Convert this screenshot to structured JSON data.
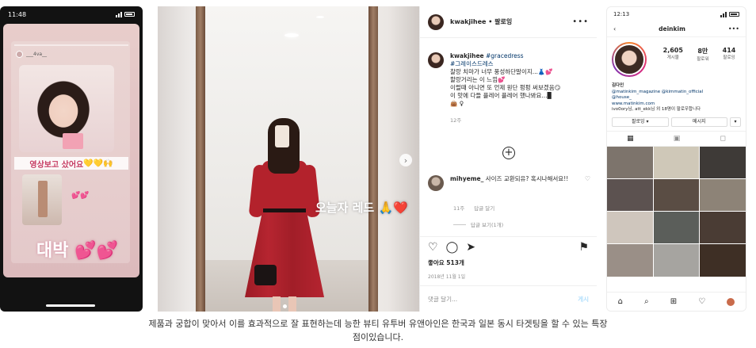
{
  "story": {
    "time": "11:48",
    "username": "___4va__",
    "caption": "영상보고 샀어요",
    "emoji": "💛💛🙌",
    "hearts": "💕💕",
    "big_text": "대박",
    "big_emoji": "💕💕"
  },
  "photo": {
    "overlay_text": "오늘자 레드",
    "overlay_emoji": "🙏❤️",
    "next_icon": "chevron-right-icon"
  },
  "post": {
    "header_user": "kwakjihee",
    "header_follow": "• 팔로잉",
    "more": "•••",
    "caption_user": "kwakjihee",
    "caption_tag1": "#gracedress",
    "caption_tag2": "#그레이스드레스",
    "caption_lines": [
      "찰랑 치마가 너무 풍성하단말이지...👗💕",
      "할랑거리는 이 느낌💕",
      "이럴때 아니면 또 언제 원단 펑펑 써보겠음😏",
      "이 맛에 다들 플레어 플레어 했나봐요...▉",
      "👜 ♀"
    ],
    "caption_ago": "12주",
    "comment_user": "mihyeme_",
    "comment_text": "사이즈 교환되유? 혹시나해서요!!",
    "comment_ago": "11주",
    "comment_reply": "답글 달기",
    "view_replies": "답글 보기(1개)",
    "likes": "좋아요 513개",
    "date": "2018년 11월 1일",
    "add_comment_placeholder": "댓글 달기...",
    "post_label": "게시"
  },
  "profile": {
    "time": "12:13",
    "username": "deinkim",
    "posts_count": "2,605",
    "posts_label": "게시물",
    "followers_count": "8만",
    "followers_label": "팔로워",
    "following_count": "414",
    "following_label": "팔로잉",
    "bio_name": "김다인",
    "bio_links1": "@matinkim_magazine @kimmatin_official",
    "bio_links2": "@house_",
    "bio_url": "www.matinkim.com",
    "bio_followers": "ivo0ory님, att_ekk님 외 18명이 팔로우합니다",
    "following_btn": "팔로잉 ▾",
    "message_btn": "메시지",
    "more_btn": "▾",
    "grid_colors": [
      "#7d746c",
      "#cfc8b8",
      "#3e3a37",
      "#5c5250",
      "#5a4d44",
      "#8d8377",
      "#cfc6bd",
      "#5b5e5a",
      "#4a3c34",
      "#9a8f87",
      "#a6a4a0",
      "#3e2f25"
    ]
  },
  "caption": {
    "line1": "제품과 궁합이 맞아서 이를 효과적으로 잘 표현하는데 능한 뷰티 유투버 유앤아인은 한국과 일본 동시 타겟팅을 할 수 있는 특장",
    "line2": "점이있습니다."
  }
}
